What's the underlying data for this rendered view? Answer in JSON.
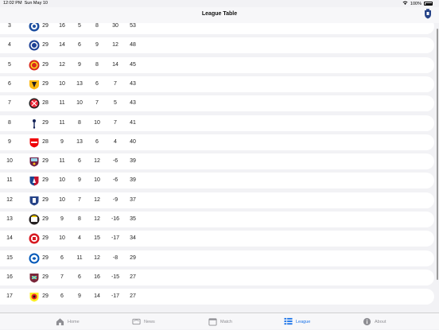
{
  "status": {
    "time": "12:02 PM",
    "date": "Sun May 10",
    "battery": "100%"
  },
  "nav": {
    "title": "League Table",
    "team_icon": "everton-crest-icon"
  },
  "rows": [
    {
      "pos": "3",
      "played": "29",
      "won": "16",
      "drawn": "5",
      "lost": "8",
      "gd": "30",
      "pts": "53",
      "crest": "leicester-crest-icon"
    },
    {
      "pos": "4",
      "played": "29",
      "won": "14",
      "drawn": "6",
      "lost": "9",
      "gd": "12",
      "pts": "48",
      "crest": "chelsea-crest-icon"
    },
    {
      "pos": "5",
      "played": "29",
      "won": "12",
      "drawn": "9",
      "lost": "8",
      "gd": "14",
      "pts": "45",
      "crest": "man-united-crest-icon"
    },
    {
      "pos": "6",
      "played": "29",
      "won": "10",
      "drawn": "13",
      "lost": "6",
      "gd": "7",
      "pts": "43",
      "crest": "wolves-crest-icon"
    },
    {
      "pos": "7",
      "played": "28",
      "won": "11",
      "drawn": "10",
      "lost": "7",
      "gd": "5",
      "pts": "43",
      "crest": "sheffield-united-crest-icon"
    },
    {
      "pos": "8",
      "played": "29",
      "won": "11",
      "drawn": "8",
      "lost": "10",
      "gd": "7",
      "pts": "41",
      "crest": "tottenham-crest-icon"
    },
    {
      "pos": "9",
      "played": "28",
      "won": "9",
      "drawn": "13",
      "lost": "6",
      "gd": "4",
      "pts": "40",
      "crest": "arsenal-crest-icon"
    },
    {
      "pos": "10",
      "played": "29",
      "won": "11",
      "drawn": "6",
      "lost": "12",
      "gd": "-6",
      "pts": "39",
      "crest": "burnley-crest-icon"
    },
    {
      "pos": "11",
      "played": "29",
      "won": "10",
      "drawn": "9",
      "lost": "10",
      "gd": "-6",
      "pts": "39",
      "crest": "crystal-palace-crest-icon"
    },
    {
      "pos": "12",
      "played": "29",
      "won": "10",
      "drawn": "7",
      "lost": "12",
      "gd": "-9",
      "pts": "37",
      "crest": "everton-crest-icon"
    },
    {
      "pos": "13",
      "played": "29",
      "won": "9",
      "drawn": "8",
      "lost": "12",
      "gd": "-16",
      "pts": "35",
      "crest": "newcastle-crest-icon"
    },
    {
      "pos": "14",
      "played": "29",
      "won": "10",
      "drawn": "4",
      "lost": "15",
      "gd": "-17",
      "pts": "34",
      "crest": "southampton-crest-icon"
    },
    {
      "pos": "15",
      "played": "29",
      "won": "6",
      "drawn": "11",
      "lost": "12",
      "gd": "-8",
      "pts": "29",
      "crest": "brighton-crest-icon"
    },
    {
      "pos": "16",
      "played": "29",
      "won": "7",
      "drawn": "6",
      "lost": "16",
      "gd": "-15",
      "pts": "27",
      "crest": "west-ham-crest-icon"
    },
    {
      "pos": "17",
      "played": "29",
      "won": "6",
      "drawn": "9",
      "lost": "14",
      "gd": "-17",
      "pts": "27",
      "crest": "watford-crest-icon"
    }
  ],
  "tabs": [
    {
      "label": "Home",
      "icon": "home-icon",
      "active": false
    },
    {
      "label": "News",
      "icon": "news-icon",
      "active": false
    },
    {
      "label": "Match",
      "icon": "calendar-icon",
      "active": false
    },
    {
      "label": "League",
      "icon": "table-icon",
      "active": true
    },
    {
      "label": "About",
      "icon": "info-icon",
      "active": false
    }
  ],
  "colors": {
    "accent": "#1a73e8",
    "inactive": "#8e8e93",
    "row_bg": "#ffffff",
    "page_bg": "#f2f2f5"
  }
}
